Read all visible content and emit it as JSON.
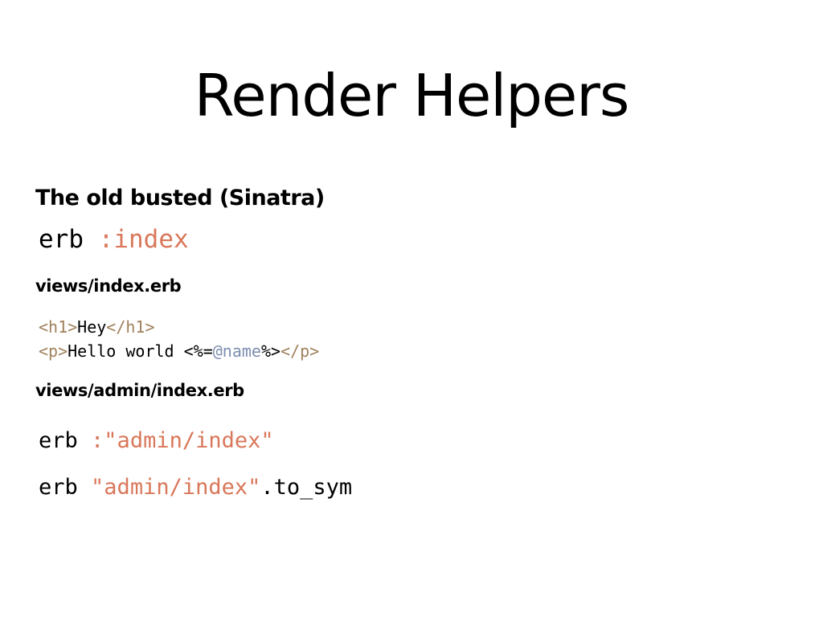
{
  "slide": {
    "title": "Render Helpers",
    "heading_main": "The old busted (Sinatra)",
    "heading_views": "views/index.erb",
    "heading_admin_views": "views/admin/index.erb"
  },
  "code": {
    "line1": {
      "keyword": "erb",
      "symbol": ":index"
    },
    "index_erb": {
      "line1": {
        "open_tag": "<h1>",
        "text": "Hey",
        "close_tag": "</h1>"
      },
      "line2": {
        "open_tag": "<p>",
        "text": "Hello world ",
        "erb_open": "<%=",
        "ivar": "@name",
        "erb_close": "%>",
        "close_tag": "</p>"
      }
    },
    "admin1": {
      "keyword": "erb",
      "symbol": ":\"admin/index\""
    },
    "admin2": {
      "keyword": "erb",
      "string": "\"admin/index\"",
      "method": ".to_sym"
    }
  },
  "colors": {
    "symbol_string": "#d9775a",
    "html_tag": "#a0815c",
    "instance_variable": "#7c8eb0",
    "text": "#000000",
    "background": "#ffffff"
  }
}
